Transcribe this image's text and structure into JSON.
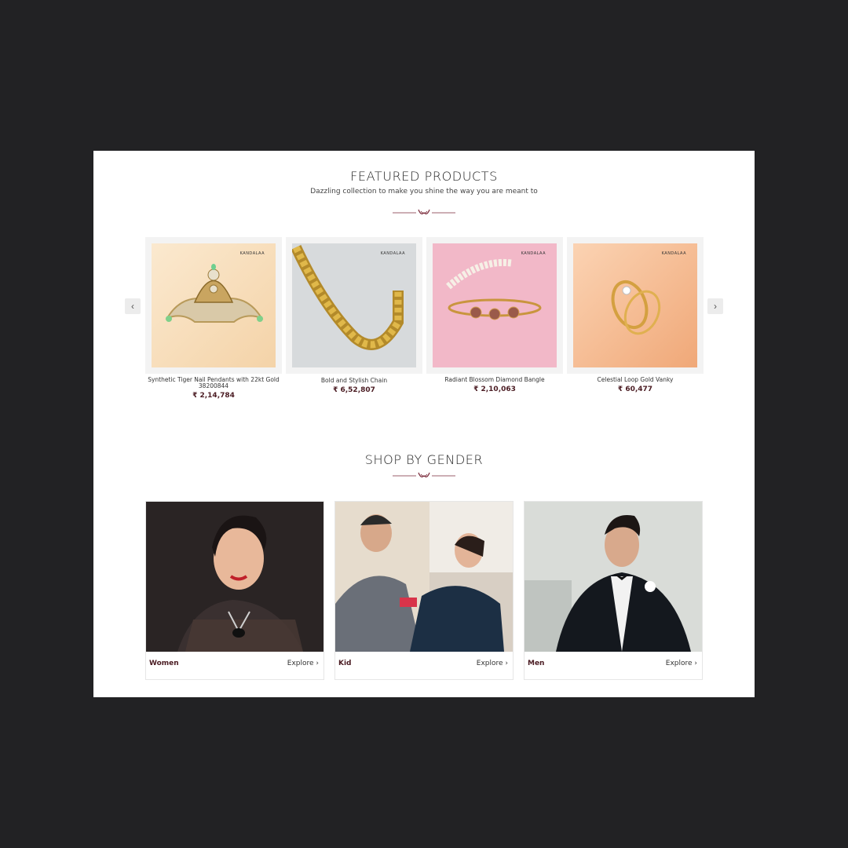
{
  "featured": {
    "title": "FEATURED PRODUCTS",
    "subtitle": "Dazzling collection to make you shine the way you are meant to",
    "prev_arrow": "‹",
    "next_arrow": "›",
    "brand": "KANDALAA",
    "products": [
      {
        "name": "Synthetic Tiger Nail Pendants with 22kt Gold 38200844",
        "price": "₹ 2,14,784"
      },
      {
        "name": "Bold and Stylish Chain",
        "price": "₹ 6,52,807"
      },
      {
        "name": "Radiant Blossom Diamond Bangle",
        "price": "₹ 2,10,063"
      },
      {
        "name": "Celestial Loop Gold Vanky",
        "price": "₹ 60,477"
      }
    ]
  },
  "gender": {
    "title": "SHOP BY GENDER",
    "cards": [
      {
        "label": "Women",
        "explore": "Explore ›"
      },
      {
        "label": "Kid",
        "explore": "Explore ›"
      },
      {
        "label": "Men",
        "explore": "Explore ›"
      }
    ]
  },
  "colors": {
    "accent": "#4a1b22",
    "backdrop": "#222224",
    "divider": "#7a2a3a"
  },
  "icons": [
    "chevron-left-icon",
    "chevron-right-icon",
    "ornament-divider-icon"
  ]
}
